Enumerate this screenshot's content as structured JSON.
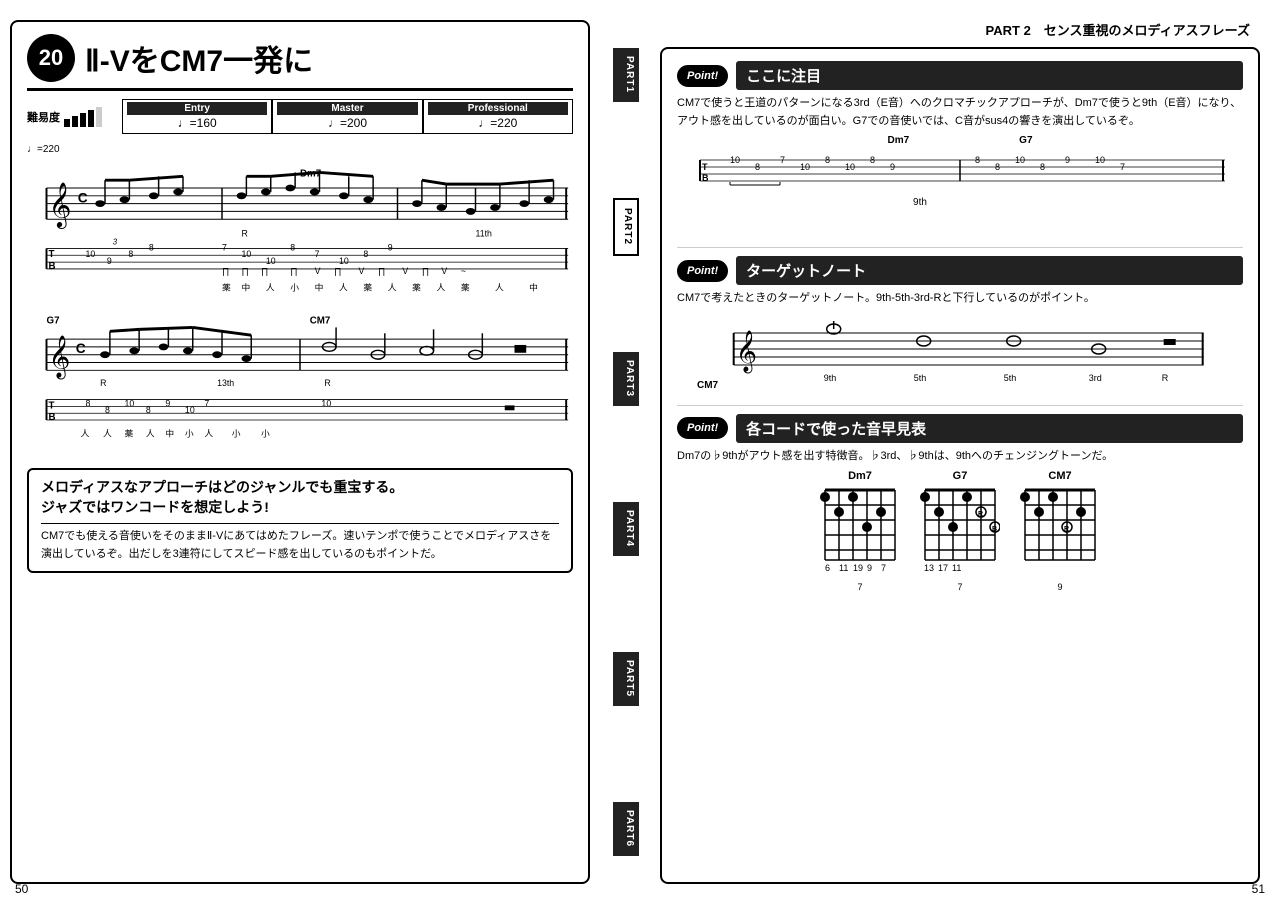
{
  "left_page": {
    "number": "50",
    "lesson_number": "20",
    "title": "Ⅱ-VをCM7一発に",
    "difficulty_label": "難易度",
    "tabs": [
      {
        "id": "part1",
        "label": "PART1",
        "active": false
      },
      {
        "id": "part2",
        "label": "PART2",
        "active": true
      },
      {
        "id": "part3",
        "label": "PART3",
        "active": false
      },
      {
        "id": "part4",
        "label": "PART4",
        "active": false
      },
      {
        "id": "part5",
        "label": "PART5",
        "active": false
      },
      {
        "id": "part6",
        "label": "PART6",
        "active": false
      }
    ],
    "tempos": [
      {
        "label": "Entry",
        "value": "♩=160"
      },
      {
        "label": "Master",
        "value": "♩=200"
      },
      {
        "label": "Professional",
        "value": "♩=220"
      }
    ],
    "info_box": {
      "title": "メロディアスなアプローチはどのジャンルでも重宝する。\nジャズではワンコードを想定しよう!",
      "body": "CM7でも使える音使いをそのままⅡ-Vにあてはめたフレーズ。速いテンポで使うことでメロディアスさを演出しているぞ。出だしを3連符にしてスピード感を出しているのもポイントだ。"
    }
  },
  "right_page": {
    "number": "51",
    "header": "PART 2　センス重視のメロディアスフレーズ",
    "points": [
      {
        "badge": "Point!",
        "title": "ここに注目",
        "body": "CM7で使うと王道のパターンになる3rd（E音）へのクロマチックアプローチが、Dm7で使うと9th（E音）になり、アウト感を出しているのが面白い。G7での音使いでは、C音がsus4の響きを演出しているぞ。",
        "sub_label": "9th"
      },
      {
        "badge": "Point!",
        "title": "ターゲットノート",
        "body": "CM7で考えたときのターゲットノート。9th-5th-3rd-Rと下行しているのがポイント。",
        "note_labels": [
          "9th",
          "5th",
          "5th",
          "3rd",
          "R"
        ],
        "chord": "CM7"
      },
      {
        "badge": "Point!",
        "title": "各コードで使った音早見表",
        "body": "Dm7の♭9thがアウト感を出す特徴音。♭3rd、♭9thは、9thへのチェンジングトーンだ。",
        "chords": [
          {
            "name": "Dm7",
            "fret": "7"
          },
          {
            "name": "G7",
            "fret": "7"
          },
          {
            "name": "CM7",
            "fret": "9"
          }
        ]
      }
    ]
  }
}
